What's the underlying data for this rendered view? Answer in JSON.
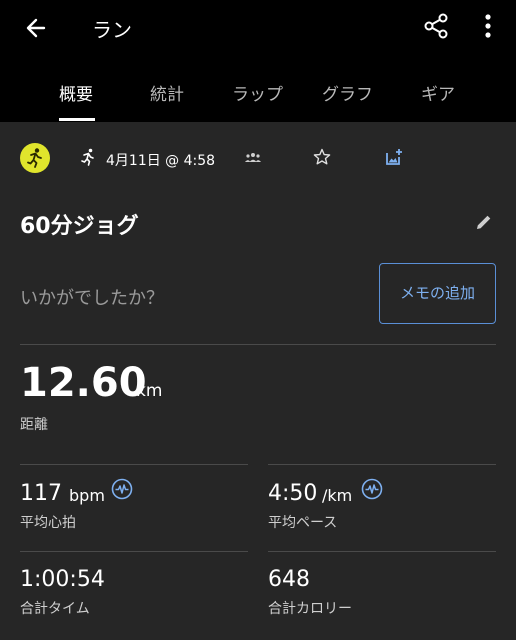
{
  "header": {
    "title": "ラン",
    "back_icon": "arrow-left-icon",
    "share_icon": "share-icon",
    "more_icon": "more-vert-icon"
  },
  "tabs": [
    {
      "label": "概要",
      "active": true
    },
    {
      "label": "統計",
      "active": false
    },
    {
      "label": "ラップ",
      "active": false
    },
    {
      "label": "グラフ",
      "active": false
    },
    {
      "label": "ギア",
      "active": false
    }
  ],
  "summary": {
    "activity_icon": "running-person-icon",
    "activity_icon_color": "#e0e52c",
    "type_icon": "run-icon",
    "date": "4月11日 @ 4:58",
    "activity_name": "60分ジョグ",
    "prompt": "いかがでしたか？",
    "memo_button": "メモの追加"
  },
  "stats": {
    "distance": {
      "value": "12.60",
      "unit": "km",
      "label": "距離"
    },
    "heart_rate": {
      "value": "117",
      "unit": "bpm",
      "label": "平均心拍"
    },
    "pace": {
      "value": "4:50",
      "unit": "/km",
      "label": "平均ペース"
    },
    "time": {
      "value": "1:00:54",
      "label": "合計タイム"
    },
    "calories": {
      "value": "648",
      "label": "合計カロリー"
    }
  },
  "colors": {
    "accent_blue": "#5a8fd6",
    "background": "#262626",
    "header_bg": "#000000"
  }
}
